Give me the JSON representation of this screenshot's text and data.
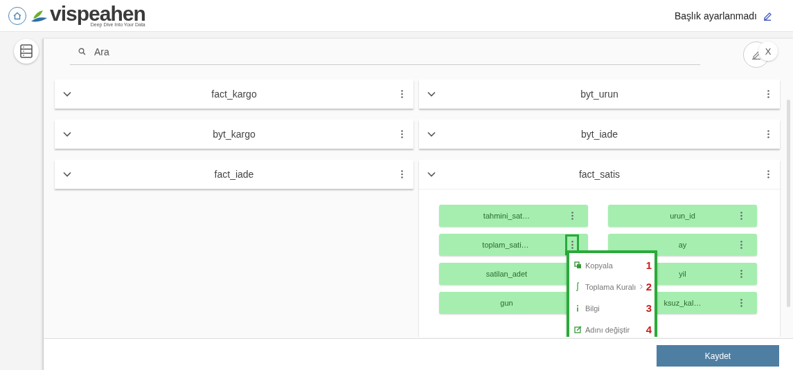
{
  "header": {
    "logo": {
      "wordmark": "vispeahen",
      "tagline": "Deep Dive Into Your Data"
    },
    "title": "Başlık ayarlanmadı"
  },
  "modal": {
    "search": {
      "placeholder": "Ara"
    },
    "close": "X",
    "panels": [
      {
        "name": "fact_kargo",
        "expanded": false
      },
      {
        "name": "byt_urun",
        "expanded": false
      },
      {
        "name": "byt_kargo",
        "expanded": false
      },
      {
        "name": "byt_iade",
        "expanded": false
      },
      {
        "name": "fact_iade",
        "expanded": false
      },
      {
        "name": "fact_satis",
        "expanded": true,
        "columns": [
          {
            "name": "tahmini_sat…",
            "highlighted": false
          },
          {
            "name": "urun_id",
            "highlighted": false
          },
          {
            "name": "toplam_sati…",
            "highlighted": true
          },
          {
            "name": "ay",
            "highlighted": false
          },
          {
            "name": "satilan_adet",
            "menu_button_covered": true
          },
          {
            "name": "yil",
            "highlighted": false
          },
          {
            "name": "gun",
            "menu_button_covered": true
          },
          {
            "name": "ksuz_kal…",
            "highlighted": false
          }
        ],
        "menu": {
          "items": [
            {
              "kind": "copy",
              "label": "Kopyala",
              "marker": "1"
            },
            {
              "kind": "integral",
              "label": "Toplama Kuralı",
              "marker": "2",
              "submenu": true
            },
            {
              "kind": "info",
              "label": "Bilgi",
              "marker": "3"
            },
            {
              "kind": "rename",
              "label": "Adını değiştir",
              "marker": "4"
            }
          ]
        }
      }
    ],
    "save": "Kaydet"
  }
}
